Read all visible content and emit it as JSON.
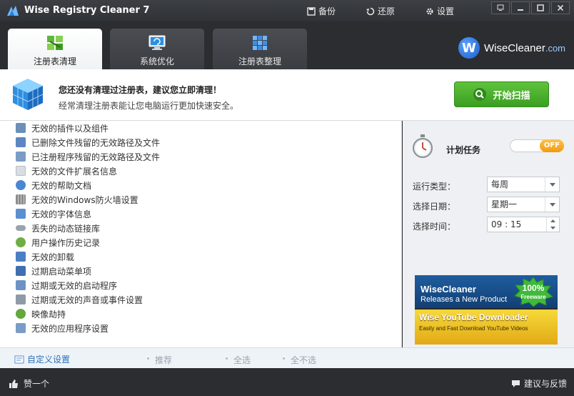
{
  "app": {
    "title": "Wise Registry Cleaner 7"
  },
  "top_actions": {
    "backup": "备份",
    "restore": "还原",
    "settings": "设置"
  },
  "tabs": [
    {
      "label": "注册表清理",
      "icon": "registry-clean-icon",
      "active": true
    },
    {
      "label": "系统优化",
      "icon": "monitor-optimize-icon",
      "active": false
    },
    {
      "label": "注册表整理",
      "icon": "defrag-blocks-icon",
      "active": false
    }
  ],
  "brand": {
    "name": "WiseCleaner",
    "domain": ".com"
  },
  "banner": {
    "title": "您还没有清理过注册表，建议您立即清理！",
    "subtitle": "经常清理注册表能让您电脑运行更加快速安全。",
    "scan_button": "开始扫描"
  },
  "items": [
    {
      "label": "无效的插件以及组件",
      "icon": "plugin-icon"
    },
    {
      "label": "已删除文件残留的无效路径及文件",
      "icon": "deleted-file-icon"
    },
    {
      "label": "已注册程序残留的无效路径及文件",
      "icon": "registered-program-icon"
    },
    {
      "label": "无效的文件扩展名信息",
      "icon": "file-extension-icon"
    },
    {
      "label": "无效的帮助文档",
      "icon": "help-doc-icon"
    },
    {
      "label": "无效的Windows防火墙设置",
      "icon": "firewall-icon"
    },
    {
      "label": "无效的字体信息",
      "icon": "font-icon"
    },
    {
      "label": "丢失的动态链接库",
      "icon": "dll-icon"
    },
    {
      "label": "用户操作历史记录",
      "icon": "history-icon"
    },
    {
      "label": "无效的卸载",
      "icon": "uninstall-icon"
    },
    {
      "label": "过期启动菜单项",
      "icon": "start-menu-icon"
    },
    {
      "label": "过期或无效的启动程序",
      "icon": "startup-icon"
    },
    {
      "label": "过期或无效的声音或事件设置",
      "icon": "sound-icon"
    },
    {
      "label": "映像劫持",
      "icon": "bug-icon"
    },
    {
      "label": "无效的应用程序设置",
      "icon": "app-settings-icon"
    }
  ],
  "schedule": {
    "label": "计划任务",
    "toggle_text": "OFF",
    "run_type_label": "运行类型：",
    "run_type_value": "每周",
    "day_label": "选择日期：",
    "day_value": "星期一",
    "time_label": "选择时间：",
    "time_value": "09 : 15"
  },
  "ad": {
    "line1": "WiseCleaner",
    "line2": "Releases a New Product",
    "burst": "100%",
    "burst_sub": "Freeware",
    "line3": "Wise YouTube Downloader",
    "line4": "Easily and Fast Download YouTube Videos"
  },
  "actions": {
    "custom": "自定义设置",
    "recommend": "推荐",
    "select_all": "全选",
    "select_none": "全不选"
  },
  "status": {
    "like": "赞一个",
    "feedback": "建议与反馈"
  },
  "colors": {
    "accent_green": "#4fb22f",
    "toggle_orange": "#f5a623",
    "link_blue": "#2c6fb7"
  }
}
